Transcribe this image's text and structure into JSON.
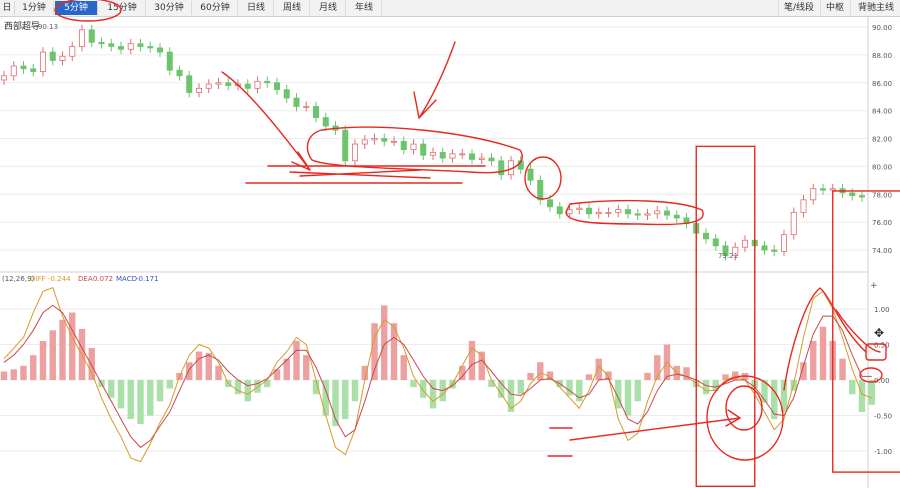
{
  "tabs": [
    "日",
    "1分钟",
    "5分钟",
    "15分钟",
    "30分钟",
    "60分钟",
    "日线",
    "周线",
    "月线",
    "年线"
  ],
  "active_tab": "5分钟",
  "right_tabs": [
    "笔/线段",
    "中枢",
    "背驰主线"
  ],
  "price_panel": {
    "label": "西部超导",
    "high_marker": "90.13",
    "low_marker": "73.21",
    "y_ticks": [
      "90.00",
      "88.00",
      "86.00",
      "84.00",
      "82.00",
      "80.00",
      "78.00",
      "76.00",
      "74.00"
    ]
  },
  "macd_panel": {
    "params": "(12,26,9)",
    "diff_label": "DIFF",
    "diff_value": "-0.244",
    "dea_label": "DEA",
    "dea_value": "0.072",
    "macd_label": "MACD",
    "macd_value": "-0.171",
    "y_ticks": [
      "1.00",
      "0.50",
      "0.00",
      "-0.50",
      "-1.00"
    ],
    "side_glyph": "+"
  },
  "colors": {
    "up": "#e07070",
    "down": "#6cc46c",
    "diff_line": "#d89a2a",
    "dea_line": "#c94a4a",
    "annotation": "#e8281e",
    "active_tab": "#2a65c9"
  },
  "chart_data": [
    {
      "type": "line",
      "title": "西部超导",
      "series": [
        {
          "values": [
            86.5,
            87.2,
            87.0,
            86.8,
            88.2,
            87.6,
            87.9,
            88.6,
            89.8,
            88.9,
            88.8,
            88.6,
            88.4,
            88.8,
            88.6,
            88.5,
            88.2,
            86.9,
            86.5,
            85.3,
            85.6,
            85.9,
            86.0,
            85.8,
            85.9,
            85.6,
            86.1,
            86.0,
            85.5,
            84.9,
            84.3,
            84.3,
            83.5,
            82.9,
            82.6,
            80.4,
            81.6,
            81.9,
            82.0,
            81.8,
            81.8,
            81.2,
            81.6,
            80.8,
            81.0,
            80.6,
            80.9,
            80.9,
            80.5,
            80.6,
            80.4,
            79.4,
            80.4,
            79.8,
            79.0,
            77.6,
            77.1,
            76.6,
            76.9,
            77.0,
            76.6,
            76.7,
            76.7,
            76.9,
            76.6,
            76.5,
            76.6,
            76.8,
            76.5,
            76.3,
            75.9,
            75.2,
            74.8,
            74.3,
            73.6,
            74.2,
            74.7,
            74.3,
            74.0,
            73.9,
            75.1,
            76.7,
            77.6,
            78.4,
            78.3,
            78.4,
            78.1,
            77.9,
            77.8
          ]
        }
      ],
      "ylim": [
        73,
        91
      ]
    },
    {
      "type": "bar",
      "title": "MACD",
      "categories": [],
      "values": [
        0.12,
        0.15,
        0.2,
        0.35,
        0.55,
        0.7,
        0.85,
        0.95,
        0.72,
        0.45,
        -0.1,
        -0.25,
        -0.4,
        -0.55,
        -0.62,
        -0.5,
        -0.3,
        -0.12,
        0.1,
        0.25,
        0.4,
        0.38,
        0.2,
        -0.1,
        -0.2,
        -0.3,
        -0.18,
        -0.1,
        0.15,
        0.3,
        0.55,
        0.35,
        -0.2,
        -0.5,
        -0.65,
        -0.55,
        -0.3,
        0.2,
        0.8,
        1.05,
        0.8,
        0.35,
        -0.1,
        -0.25,
        -0.4,
        -0.3,
        -0.12,
        0.2,
        0.55,
        0.4,
        -0.1,
        -0.25,
        -0.45,
        -0.2,
        0.1,
        0.25,
        0.12,
        -0.1,
        -0.22,
        -0.3,
        0.08,
        0.3,
        0.12,
        -0.4,
        -0.5,
        -0.3,
        0.1,
        0.35,
        0.5,
        0.2,
        0.18,
        -0.1,
        -0.2,
        -0.15,
        0.08,
        0.12,
        0.1,
        -0.12,
        -0.32,
        -0.55,
        -0.45,
        -0.15,
        0.25,
        0.55,
        0.75,
        0.55,
        0.3,
        -0.2,
        -0.45,
        -0.35
      ],
      "series": [
        {
          "name": "DIFF",
          "values": [
            0.3,
            0.45,
            0.6,
            0.95,
            1.25,
            1.3,
            0.9,
            0.6,
            0.35,
            0.1,
            -0.25,
            -0.55,
            -0.8,
            -1.1,
            -1.15,
            -0.9,
            -0.6,
            -0.35,
            0.05,
            0.35,
            0.5,
            0.45,
            0.25,
            -0.05,
            -0.15,
            -0.2,
            -0.1,
            0.0,
            0.25,
            0.4,
            0.6,
            0.5,
            0.0,
            -0.5,
            -0.95,
            -1.05,
            -0.7,
            0.0,
            0.6,
            0.85,
            0.75,
            0.45,
            0.05,
            -0.15,
            -0.3,
            -0.2,
            -0.05,
            0.2,
            0.45,
            0.35,
            0.0,
            -0.2,
            -0.4,
            -0.3,
            -0.05,
            0.1,
            0.05,
            -0.1,
            -0.25,
            -0.4,
            -0.15,
            0.2,
            0.05,
            -0.55,
            -0.85,
            -0.75,
            -0.3,
            0.05,
            0.25,
            0.1,
            0.05,
            -0.05,
            -0.15,
            -0.15,
            0.0,
            0.05,
            0.0,
            -0.2,
            -0.45,
            -0.7,
            -0.55,
            -0.05,
            0.6,
            1.15,
            1.25,
            1.0,
            0.6,
            0.15,
            -0.2,
            -0.25
          ]
        },
        {
          "name": "DEA",
          "values": [
            0.25,
            0.35,
            0.5,
            0.7,
            0.95,
            1.05,
            0.95,
            0.7,
            0.45,
            0.2,
            -0.05,
            -0.3,
            -0.55,
            -0.8,
            -0.95,
            -0.85,
            -0.65,
            -0.45,
            -0.15,
            0.15,
            0.3,
            0.35,
            0.28,
            0.12,
            0.0,
            -0.08,
            -0.05,
            0.02,
            0.15,
            0.28,
            0.42,
            0.42,
            0.18,
            -0.15,
            -0.55,
            -0.8,
            -0.7,
            -0.3,
            0.15,
            0.5,
            0.6,
            0.5,
            0.28,
            0.05,
            -0.12,
            -0.15,
            -0.08,
            0.05,
            0.22,
            0.28,
            0.12,
            -0.05,
            -0.2,
            -0.22,
            -0.12,
            0.0,
            0.02,
            -0.05,
            -0.15,
            -0.25,
            -0.2,
            0.0,
            0.02,
            -0.25,
            -0.55,
            -0.62,
            -0.45,
            -0.15,
            0.05,
            0.08,
            0.05,
            0.0,
            -0.08,
            -0.1,
            -0.05,
            0.0,
            0.0,
            -0.1,
            -0.28,
            -0.48,
            -0.5,
            -0.25,
            0.2,
            0.65,
            0.9,
            0.9,
            0.7,
            0.35,
            0.05,
            0.05
          ]
        }
      ],
      "ylim": [
        -1.3,
        1.3
      ]
    }
  ],
  "annotations": {
    "boxes": [
      {
        "x0": 71,
        "x1": 77,
        "ylo": -1.3,
        "yhi": 80.0
      },
      {
        "x0": 85,
        "x1": 92,
        "ylo": -1.1,
        "yhi": 76.8
      }
    ]
  }
}
